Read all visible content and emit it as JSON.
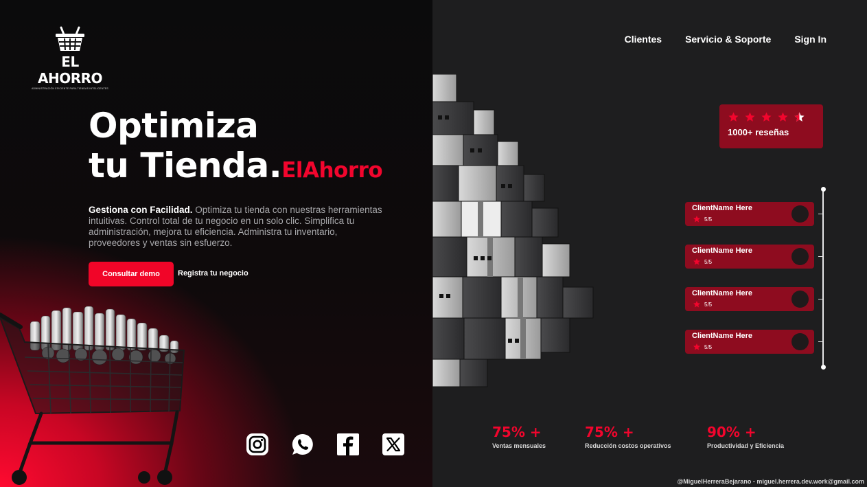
{
  "brand": {
    "name": "EL AHORRO",
    "tagline": "ADMINISTRACIÓN EFICIENTE PARA TIENDAS INTELIGENTES"
  },
  "nav": {
    "items": [
      "Clientes",
      "Servicio & Soporte",
      "Sign In"
    ]
  },
  "hero": {
    "title_line1": "Optimiza",
    "title_line2": "tu Tienda.",
    "title_accent": "ElAhorro",
    "desc_bold": "Gestiona con Facilidad.",
    "desc_rest": " Optimiza tu tienda con nuestras herramientas intuitivas. Control total de tu negocio en un solo clic. Simplifica tu administración, mejora tu eficiencia. Administra tu inventario, proveedores y ventas sin esfuerzo.",
    "primary_button": "Consultar demo",
    "secondary_button": "Registra tu negocio"
  },
  "socials": {
    "icons": [
      "instagram-icon",
      "whatsapp-icon",
      "facebook-icon",
      "x-icon"
    ]
  },
  "rating": {
    "stars": 4.5,
    "max_stars": 5,
    "label": "1000+ reseñas"
  },
  "testimonials": [
    {
      "name": "ClientName Here",
      "score": "5/5"
    },
    {
      "name": "ClientName Here",
      "score": "5/5"
    },
    {
      "name": "ClientName Here",
      "score": "5/5"
    },
    {
      "name": "ClientName Here",
      "score": "5/5"
    }
  ],
  "stats": [
    {
      "value": "75% +",
      "label": "Ventas mensuales"
    },
    {
      "value": "75% +",
      "label": "Reducción costos operativos"
    },
    {
      "value": "90% +",
      "label": "Productividad y Eficiencia"
    }
  ],
  "credit": "@MiguelHerreraBejarano - miguel.herrera.dev.work@gmail.com",
  "colors": {
    "accent": "#f2052d",
    "card": "#8e0c1f",
    "panel_dark": "#1e1e1f"
  }
}
